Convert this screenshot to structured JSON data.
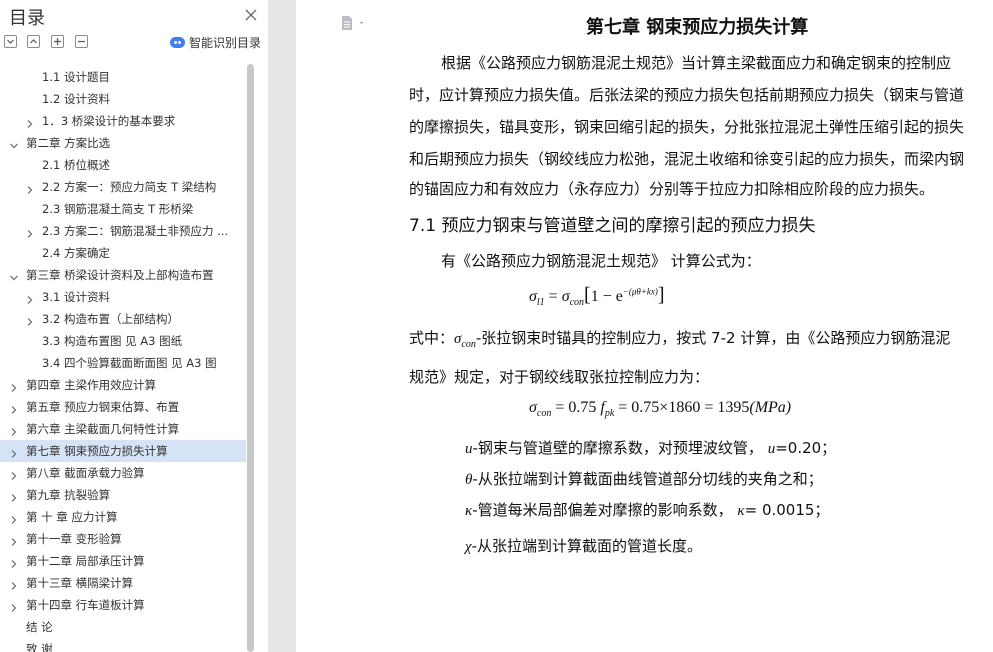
{
  "nav": {
    "title": "目录",
    "smart_toc_label": "智能识别目录",
    "items": [
      {
        "label": "1.1 设计题目",
        "level": 2,
        "arrow": "none"
      },
      {
        "label": "1.2  设计资料",
        "level": 2,
        "arrow": "none"
      },
      {
        "label": "1．3  桥梁设计的基本要求",
        "level": 2,
        "arrow": "right"
      },
      {
        "label": "第二章  方案比选",
        "level": 1,
        "arrow": "down"
      },
      {
        "label": "2.1 桥位概述",
        "level": 2,
        "arrow": "none"
      },
      {
        "label": "2.2  方案一：预应力简支 T 梁结构",
        "level": 2,
        "arrow": "right"
      },
      {
        "label": "2.3  钢筋混凝土简支 T 形桥梁",
        "level": 2,
        "arrow": "none"
      },
      {
        "label": "2.3  方案二：钢筋混凝土非预应力 ...",
        "level": 2,
        "arrow": "right"
      },
      {
        "label": "2.4  方案确定",
        "level": 2,
        "arrow": "none"
      },
      {
        "label": "第三章  桥梁设计资料及上部构造布置",
        "level": 1,
        "arrow": "down"
      },
      {
        "label": "3.1 设计资料",
        "level": 2,
        "arrow": "right"
      },
      {
        "label": "3.2 构造布置（上部结构）",
        "level": 2,
        "arrow": "right"
      },
      {
        "label": "3.3 构造布置图  见 A3 图纸",
        "level": 2,
        "arrow": "none"
      },
      {
        "label": "3.4  四个验算截面断面图  见 A3 图",
        "level": 2,
        "arrow": "none"
      },
      {
        "label": "第四章  主梁作用效应计算",
        "level": 1,
        "arrow": "right"
      },
      {
        "label": "第五章  预应力钢束估算、布置",
        "level": 1,
        "arrow": "right"
      },
      {
        "label": "第六章  主梁截面几何特性计算",
        "level": 1,
        "arrow": "right"
      },
      {
        "label": "第七章  钢束预应力损失计算",
        "level": 1,
        "arrow": "right",
        "selected": true
      },
      {
        "label": "第八章    截面承载力验算",
        "level": 1,
        "arrow": "right"
      },
      {
        "label": "第九章  抗裂验算",
        "level": 1,
        "arrow": "right"
      },
      {
        "label": "第  十  章  应力计算",
        "level": 1,
        "arrow": "right"
      },
      {
        "label": "第十一章  变形验算",
        "level": 1,
        "arrow": "right"
      },
      {
        "label": "第十二章  局部承压计算",
        "level": 1,
        "arrow": "right"
      },
      {
        "label": "第十三章  横隔梁计算",
        "level": 1,
        "arrow": "right"
      },
      {
        "label": "第十四章  行车道板计算",
        "level": 1,
        "arrow": "right"
      },
      {
        "label": "结    论",
        "level": 1,
        "arrow": "none"
      },
      {
        "label": "致    谢",
        "level": 1,
        "arrow": "none"
      }
    ]
  },
  "doc": {
    "chapter_title": "第七章  钢束预应力损失计算",
    "intro_lines": [
      "根据《公路预应力钢筋混泥土规范》当计算主梁截面应力和确定钢束的控制应",
      "时，应计算预应力损失值。后张法梁的预应力损失包括前期预应力损失（钢束与管道",
      "的摩擦损失，锚具变形，钢束回缩引起的损失，分批张拉混泥土弹性压缩引起的损失",
      "和后期预应力损失（钢绞线应力松弛，混泥土收缩和徐变引起的应力损失，而梁内钢",
      "的锚固应力和有效应力（永存应力）分别等于拉应力扣除相应阶段的应力损失。"
    ],
    "section_title": "7.1  预应力钢束与管道壁之间的摩擦引起的预应力损失",
    "formula_intro": "有《公路预应力钢筋混泥土规范》 计算公式为：",
    "formula1": {
      "lhs_symbol": "σ",
      "lhs_sub": "l1",
      "eq": "=",
      "rhs_symbol": "σ",
      "rhs_sub": "con",
      "bracket_body": "1 − e",
      "exponent": "−(μθ+kx)"
    },
    "where_line1_prefix": "式中：",
    "where_symbol": "σ",
    "where_sub": "con",
    "where_line1_text": "-张拉钢束时锚具的控制应力，按式 7-2 计算，由《公路预应力钢筋混泥",
    "where_line2_text": "规范》规定，对于钢绞线取张拉控制应力为：",
    "formula2": {
      "lhs_symbol": "σ",
      "lhs_sub": "con",
      "rest_a": "= 0.75",
      "f_symbol": "f",
      "f_sub": "pk",
      "rest_b": "= 0.75×1860 = 1395",
      "unit": "(MPa)"
    },
    "defs": [
      {
        "symbol": "u",
        "text": "-钢束与管道壁的摩擦系数，对预埋波纹管，",
        "tail_symbol": "u",
        "tail_text": "=0.20；"
      },
      {
        "symbol": "θ",
        "text": "-从张拉端到计算截面曲线管道部分切线的夹角之和；"
      },
      {
        "symbol": "κ",
        "text": "-管道每米局部偏差对摩擦的影响系数，",
        "tail_symbol": "κ",
        "tail_text": "= 0.0015；"
      },
      {
        "symbol": "χ",
        "text": "-从张拉端到计算截面的管道长度。"
      }
    ]
  },
  "colors": {
    "selected_row": "#d6e2f6",
    "canvas": "#e6e6e6",
    "accent": "#3d7ff0"
  }
}
